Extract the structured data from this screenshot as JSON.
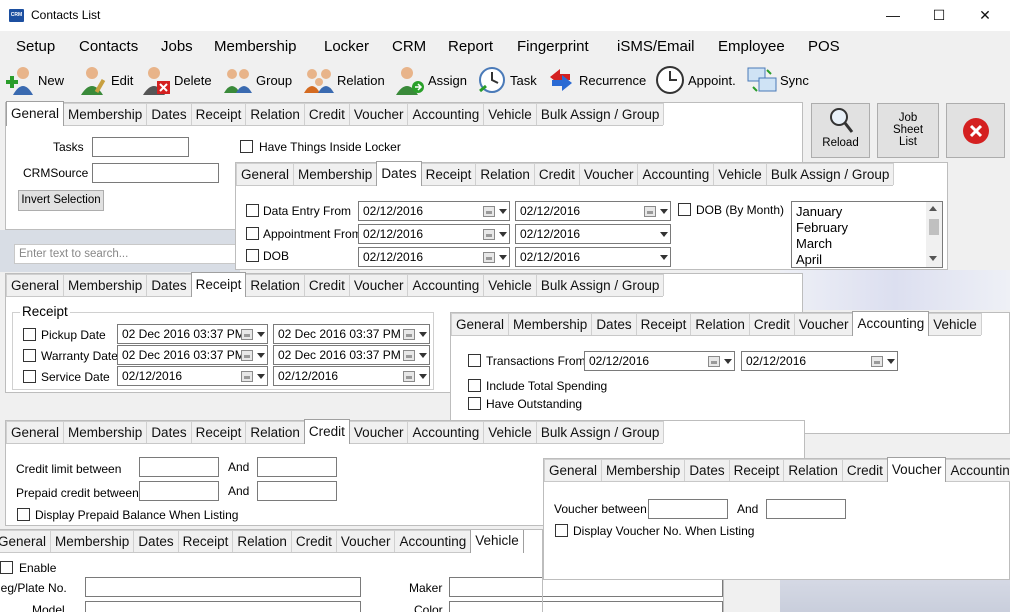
{
  "window": {
    "title": "Contacts List",
    "logo_text": "CRM",
    "minimize": "—",
    "maximize": "☐",
    "close": "✕"
  },
  "menu": [
    "Setup",
    "Contacts",
    "Jobs",
    "Membership",
    "Locker",
    "CRM",
    "Report",
    "Fingerprint",
    "iSMS/Email",
    "Employee",
    "POS"
  ],
  "toolbar": {
    "new": "New",
    "edit": "Edit",
    "delete": "Delete",
    "group": "Group",
    "relation": "Relation",
    "assign": "Assign",
    "task": "Task",
    "recurrence": "Recurrence",
    "appoint": "Appoint.",
    "sync": "Sync"
  },
  "right_buttons": {
    "reload": "Reload",
    "job_sheet": "Job Sheet List"
  },
  "tabs_full": [
    "General",
    "Membership",
    "Dates",
    "Receipt",
    "Relation",
    "Credit",
    "Voucher",
    "Accounting",
    "Vehicle",
    "Bulk Assign / Group"
  ],
  "general": {
    "tasks_label": "Tasks",
    "crmsource_label": "CRMSource",
    "invert_button": "Invert Selection",
    "locker_label": "Have Things Inside Locker",
    "search_placeholder": "Enter text to search..."
  },
  "dates": {
    "entry_label": "Data Entry From",
    "appt_label": "Appointment From",
    "dob_label": "DOB",
    "dob_month_label": "DOB (By Month)",
    "date_value": "02/12/2016",
    "months": [
      "January",
      "February",
      "March",
      "April"
    ]
  },
  "receipt": {
    "group_title": "Receipt",
    "pickup_label": "Pickup Date",
    "warranty_label": "Warranty Date",
    "service_label": "Service Date",
    "datetime_value": "02 Dec 2016 03:37 PM",
    "date_value": "02/12/2016"
  },
  "accounting": {
    "transactions_label": "Transactions From",
    "date_value": "02/12/2016",
    "total_spending_label": "Include Total Spending",
    "outstanding_label": "Have Outstanding"
  },
  "credit": {
    "limit_label": "Credit limit between",
    "prepaid_label": "Prepaid credit between",
    "and_label": "And",
    "display_prepaid_label": "Display Prepaid Balance When Listing"
  },
  "voucher": {
    "between_label": "Voucher between",
    "and_label": "And",
    "display_label": "Display Voucher No. When Listing"
  },
  "vehicle": {
    "enable_label": "Enable",
    "plate_label": "Reg/Plate No.",
    "maker_label": "Maker",
    "model_label": "Model",
    "color_label": "Color"
  }
}
